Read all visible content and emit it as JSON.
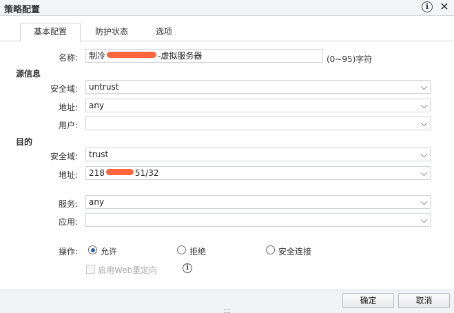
{
  "window": {
    "title": "策略配置"
  },
  "tabs": [
    {
      "label": "基本配置"
    },
    {
      "label": "防护状态"
    },
    {
      "label": "选项"
    }
  ],
  "form": {
    "name_label": "名称:",
    "name_value_prefix": "制冷",
    "name_value_suffix": "-虚拟服务器",
    "name_hint": "(0~95)字符",
    "source_section": "源信息",
    "source_zone_label": "安全域:",
    "source_zone_value": "untrust",
    "source_addr_label": "地址:",
    "source_addr_value": "any",
    "source_user_label": "用户:",
    "source_user_value": "",
    "dest_section": "目的",
    "dest_zone_label": "安全域:",
    "dest_zone_value": "trust",
    "dest_addr_label": "地址:",
    "dest_addr_prefix": "218",
    "dest_addr_suffix": "51/32",
    "service_label": "服务:",
    "service_value": "any",
    "app_label": "应用:",
    "app_value": "",
    "action_label": "操作:",
    "actions": [
      {
        "label": "允许",
        "selected": true
      },
      {
        "label": "拒绝",
        "selected": false
      },
      {
        "label": "安全连接",
        "selected": false
      }
    ],
    "web_redirect_label": "启用Web重定向",
    "web_redirect_checked": false
  },
  "footer": {
    "ok_label": "确定",
    "cancel_label": "取消"
  },
  "colors": {
    "accent_radio": "#1f5fb5",
    "redaction": "#ff4a1a",
    "border": "#cfd3d8"
  },
  "icons": {
    "info": "info-icon",
    "close": "close-icon",
    "dropdown": "chevron-down-icon"
  }
}
